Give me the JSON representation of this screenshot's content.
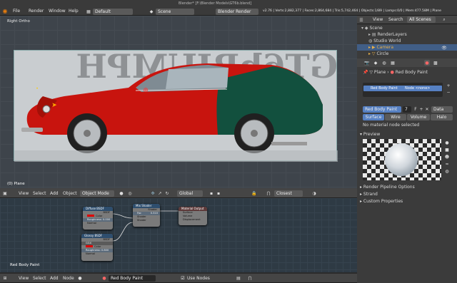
{
  "top_menu": {
    "window_title": "Blender* [F:\\Blender Models\\GT6b.blend]",
    "menus": [
      "File",
      "Render",
      "Window",
      "Help"
    ],
    "layout": "Default",
    "scene": "Scene",
    "engine": "Blender Render",
    "stats": "v2.76 | Verts:2,882,377 | Faces:2,864,684 | Tris:5,742,464 | Objects:1/89 | Lamps:0/0 | Mem:477.58M | Plane"
  },
  "viewport": {
    "view_name": "Right Ortho",
    "object_label": "(0) Plane",
    "header_menus": [
      "View",
      "Select",
      "Add",
      "Object"
    ],
    "mode": "Object Mode",
    "orientation": "Global",
    "snap": "Closest"
  },
  "node_editor": {
    "material_label": "Red Body Paint",
    "header_menus": [
      "View",
      "Select",
      "Add",
      "Node"
    ],
    "material_name": "Red Body Paint",
    "use_nodes_label": "Use Nodes",
    "nodes": {
      "diffuse": {
        "title": "Diffuse BSDF",
        "out": "BSDF",
        "color": "Color",
        "roughness": "Roughness: 0.000",
        "normal": "Normal"
      },
      "glossy": {
        "title": "Glossy BSDF",
        "out": "BSDF",
        "ggx": "GGX",
        "color": "Color",
        "roughness": "Roughness: 0.800",
        "normal": "Normal"
      },
      "mix": {
        "title": "Mix Shader",
        "out": "Shader",
        "fac": "Fac",
        "fac_val": "0.310",
        "shader1": "Shader",
        "shader2": "Shader"
      },
      "output": {
        "title": "Material Output",
        "surface": "Surface",
        "volume": "Volume",
        "displacement": "Displacement"
      }
    }
  },
  "outliner": {
    "header_menus": [
      "View",
      "Search"
    ],
    "filter": "All Scenes",
    "items": [
      "Scene",
      "RenderLayers",
      "Studio World",
      "Camera",
      "Circle"
    ]
  },
  "properties": {
    "object_name": "Plane",
    "material_name": "Red Body Paint",
    "slot": "Red Body Paint",
    "node_label": "Node <none>",
    "material_field": "Red Body Paint",
    "users": "7",
    "data_label": "Data",
    "tabs": [
      "Surface",
      "Wire",
      "Volume",
      "Halo"
    ],
    "no_node": "No material node selected",
    "preview_label": "Preview",
    "panels": [
      "Render Pipeline Options",
      "Strand",
      "Custom Properties"
    ]
  },
  "colors": {
    "accent": "#5680c2",
    "car_red": "#c8140e",
    "car_green": "#12503e",
    "outliner_select": "#415e86"
  }
}
